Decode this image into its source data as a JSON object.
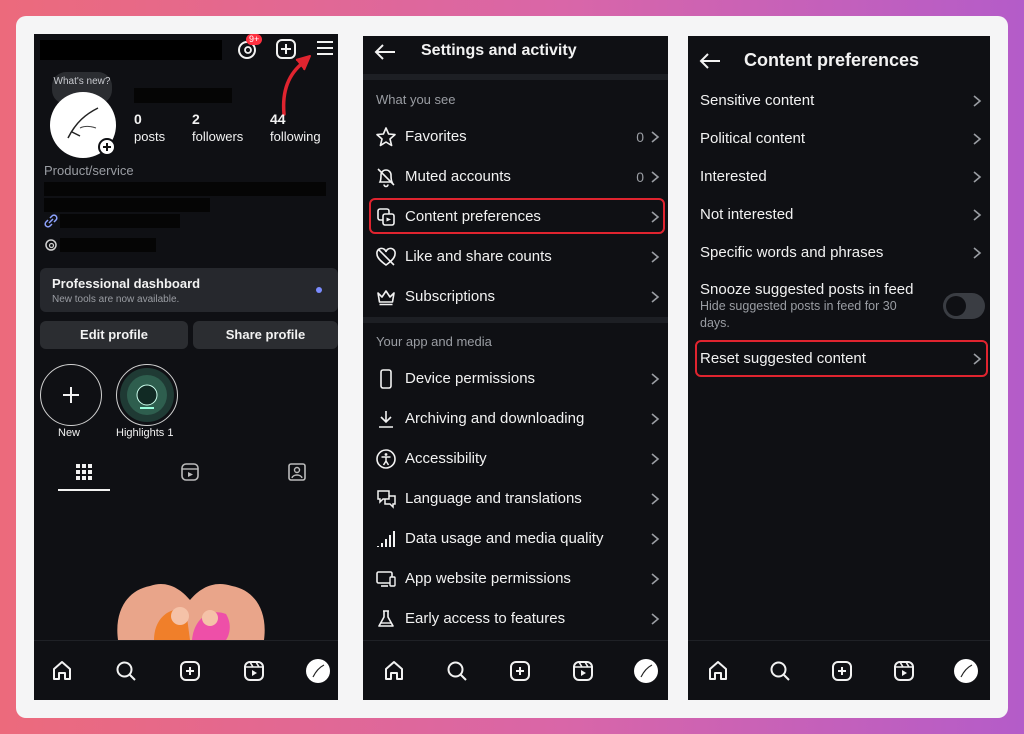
{
  "profile": {
    "whats_new": "What's new?",
    "notif_badge": "9+",
    "stats": [
      {
        "num": "0",
        "label": "posts"
      },
      {
        "num": "2",
        "label": "followers"
      },
      {
        "num": "44",
        "label": "following"
      }
    ],
    "category": "Product/service",
    "dashboard_title": "Professional dashboard",
    "dashboard_sub": "New tools are now available.",
    "edit_profile": "Edit profile",
    "share_profile": "Share profile",
    "new_label": "New",
    "highlight_label": "Highlights 1"
  },
  "settings": {
    "title": "Settings and activity",
    "section1": "What you see",
    "items1": [
      {
        "label": "Favorites",
        "count": "0",
        "icon": "star-icon"
      },
      {
        "label": "Muted accounts",
        "count": "0",
        "icon": "bell-off-icon"
      },
      {
        "label": "Content preferences",
        "count": "",
        "icon": "content-icon"
      },
      {
        "label": "Like and share counts",
        "count": "",
        "icon": "heart-off-icon"
      },
      {
        "label": "Subscriptions",
        "count": "",
        "icon": "crown-icon"
      }
    ],
    "section2": "Your app and media",
    "items2": [
      {
        "label": "Device permissions",
        "icon": "phone-icon"
      },
      {
        "label": "Archiving and downloading",
        "icon": "download-icon"
      },
      {
        "label": "Accessibility",
        "icon": "accessibility-icon"
      },
      {
        "label": "Language and translations",
        "icon": "language-icon"
      },
      {
        "label": "Data usage and media quality",
        "icon": "signal-icon"
      },
      {
        "label": "App website permissions",
        "icon": "monitor-icon"
      },
      {
        "label": "Early access to features",
        "icon": "flask-icon"
      }
    ]
  },
  "content_prefs": {
    "title": "Content preferences",
    "items": [
      "Sensitive content",
      "Political content",
      "Interested",
      "Not interested",
      "Specific words and phrases"
    ],
    "snooze_title": "Snooze suggested posts in feed",
    "snooze_sub": "Hide suggested posts in feed for 30 days.",
    "snooze_on": false,
    "reset": "Reset suggested content"
  },
  "colors": {
    "highlight": "#e0242f",
    "accent_dot": "#7b8cff"
  }
}
